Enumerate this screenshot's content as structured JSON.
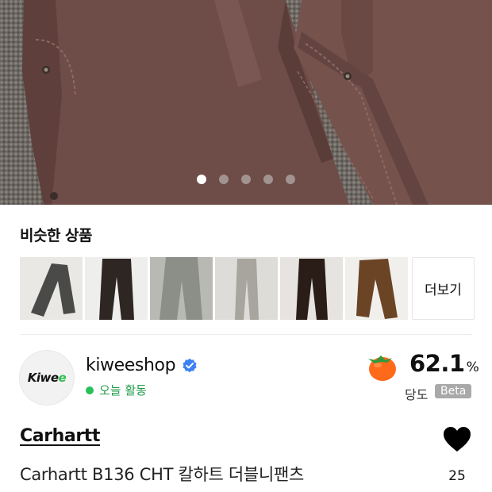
{
  "hero": {
    "dots_total": 5,
    "active_index": 0
  },
  "similar": {
    "title": "비슷한 상품",
    "more_label": "더보기",
    "thumbnails": [
      {
        "name": "gray-cargo-pants",
        "color": "#4a4a48"
      },
      {
        "name": "dark-brown-pants",
        "color": "#2e2622"
      },
      {
        "name": "gray-wide-pants",
        "color": "#8c8f88"
      },
      {
        "name": "light-gray-pants",
        "color": "#a7a59e"
      },
      {
        "name": "dark-brown-pants-2",
        "color": "#2a1d18"
      },
      {
        "name": "brown-work-pants",
        "color": "#6b4426"
      }
    ]
  },
  "shop": {
    "logo_text_a": "Kiwe",
    "logo_text_b": "e",
    "name": "kiweeshop",
    "activity": "오늘 활동",
    "sweetness_value": "62.1",
    "sweetness_unit": "%",
    "sweetness_label": "당도",
    "beta_label": "Beta"
  },
  "product": {
    "brand": "Carhartt",
    "title": "Carhartt B136 CHT 칼하트 더블니팬츠",
    "likes": "25"
  },
  "colors": {
    "accent_green": "#27c15a",
    "verified_blue": "#3b82f6",
    "pants_brown": "#6e4c48",
    "fruit_orange": "#ff6a1a"
  }
}
